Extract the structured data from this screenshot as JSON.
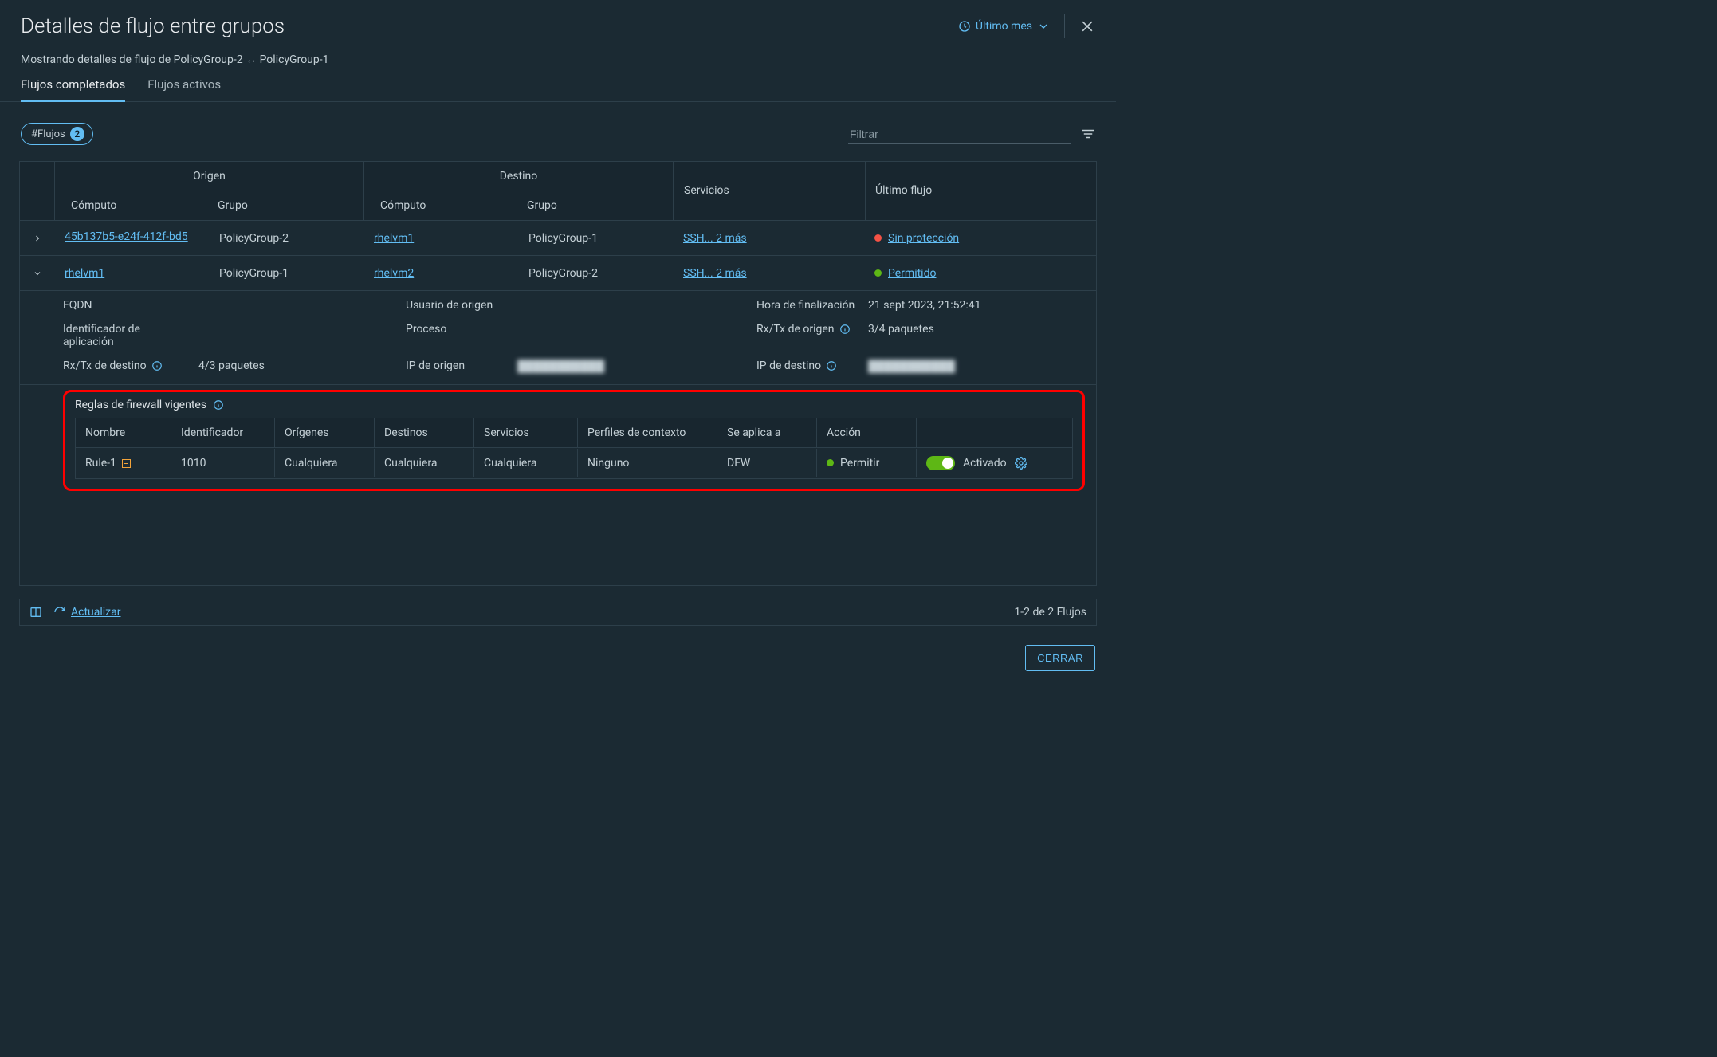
{
  "header": {
    "title": "Detalles de flujo entre grupos",
    "timeRange": "Último mes"
  },
  "subtitle": "Mostrando detalles de flujo de PolicyGroup-2 ↔ PolicyGroup-1",
  "tabs": [
    {
      "label": "Flujos completados",
      "active": true
    },
    {
      "label": "Flujos activos",
      "active": false
    }
  ],
  "chip": {
    "label": "#Flujos",
    "count": "2"
  },
  "filter": {
    "placeholder": "Filtrar"
  },
  "columns": {
    "origen": "Origen",
    "destino": "Destino",
    "computo": "Cómputo",
    "grupo": "Grupo",
    "servicios": "Servicios",
    "ultimoFlujo": "Último flujo"
  },
  "rows": [
    {
      "expanded": false,
      "origenComputo": "45b137b5-e24f-412f-bd5",
      "origenGrupo": "PolicyGroup-2",
      "destinoComputo": "rhelvm1",
      "destinoGrupo": "PolicyGroup-1",
      "servicios": "SSH... 2 más",
      "statusColor": "red",
      "statusText": "Sin protección"
    },
    {
      "expanded": true,
      "origenComputo": "rhelvm1",
      "origenGrupo": "PolicyGroup-1",
      "destinoComputo": "rhelvm2",
      "destinoGrupo": "PolicyGroup-2",
      "servicios": "SSH... 2 más",
      "statusColor": "green",
      "statusText": "Permitido"
    }
  ],
  "details": {
    "fqdnLabel": "FQDN",
    "fqdnVal": "",
    "usuarioOrigenLabel": "Usuario de origen",
    "usuarioOrigenVal": "",
    "horaFinLabel": "Hora de finalización",
    "horaFinVal": "21 sept 2023, 21:52:41",
    "idAppLabel": "Identificador de aplicación",
    "idAppVal": "",
    "procesoLabel": "Proceso",
    "procesoVal": "",
    "rxtxOrigenLabel": "Rx/Tx de origen",
    "rxtxOrigenVal": "3/4 paquetes",
    "rxtxDestinoLabel": "Rx/Tx de destino",
    "rxtxDestinoVal": "4/3 paquetes",
    "ipOrigenLabel": "IP de origen",
    "ipOrigenVal": "███████████",
    "ipDestinoLabel": "IP de destino",
    "ipDestinoVal": "███████████"
  },
  "firewall": {
    "title": "Reglas de firewall vigentes",
    "headers": {
      "nombre": "Nombre",
      "id": "Identificador",
      "origenes": "Orígenes",
      "destinos": "Destinos",
      "servicios": "Servicios",
      "contexto": "Perfiles de contexto",
      "seAplica": "Se aplica a",
      "accion": "Acción"
    },
    "rule": {
      "nombre": "Rule-1",
      "id": "1010",
      "origenes": "Cualquiera",
      "destinos": "Cualquiera",
      "servicios": "Cualquiera",
      "contexto": "Ninguno",
      "seAplica": "DFW",
      "accion": "Permitir",
      "toggleLabel": "Activado"
    }
  },
  "footer": {
    "refresh": "Actualizar",
    "summary": "1-2 de 2 Flujos"
  },
  "actions": {
    "close": "CERRAR"
  }
}
